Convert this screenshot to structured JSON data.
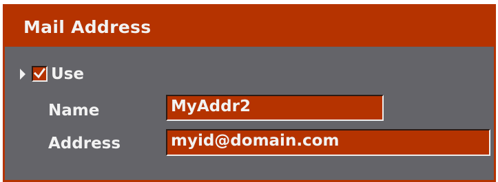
{
  "panel": {
    "title": "Mail Address"
  },
  "use": {
    "label": "Use",
    "checked": true
  },
  "fields": {
    "name_label": "Name",
    "name_value": "MyAddr2",
    "address_label": "Address",
    "address_value": "myid@domain.com"
  },
  "colors": {
    "accent": "#b53300",
    "panel_bg": "#646469",
    "text": "#f2f2f2"
  },
  "icons": {
    "focus_indicator": "triangle-right-icon",
    "check": "checkmark-icon"
  }
}
